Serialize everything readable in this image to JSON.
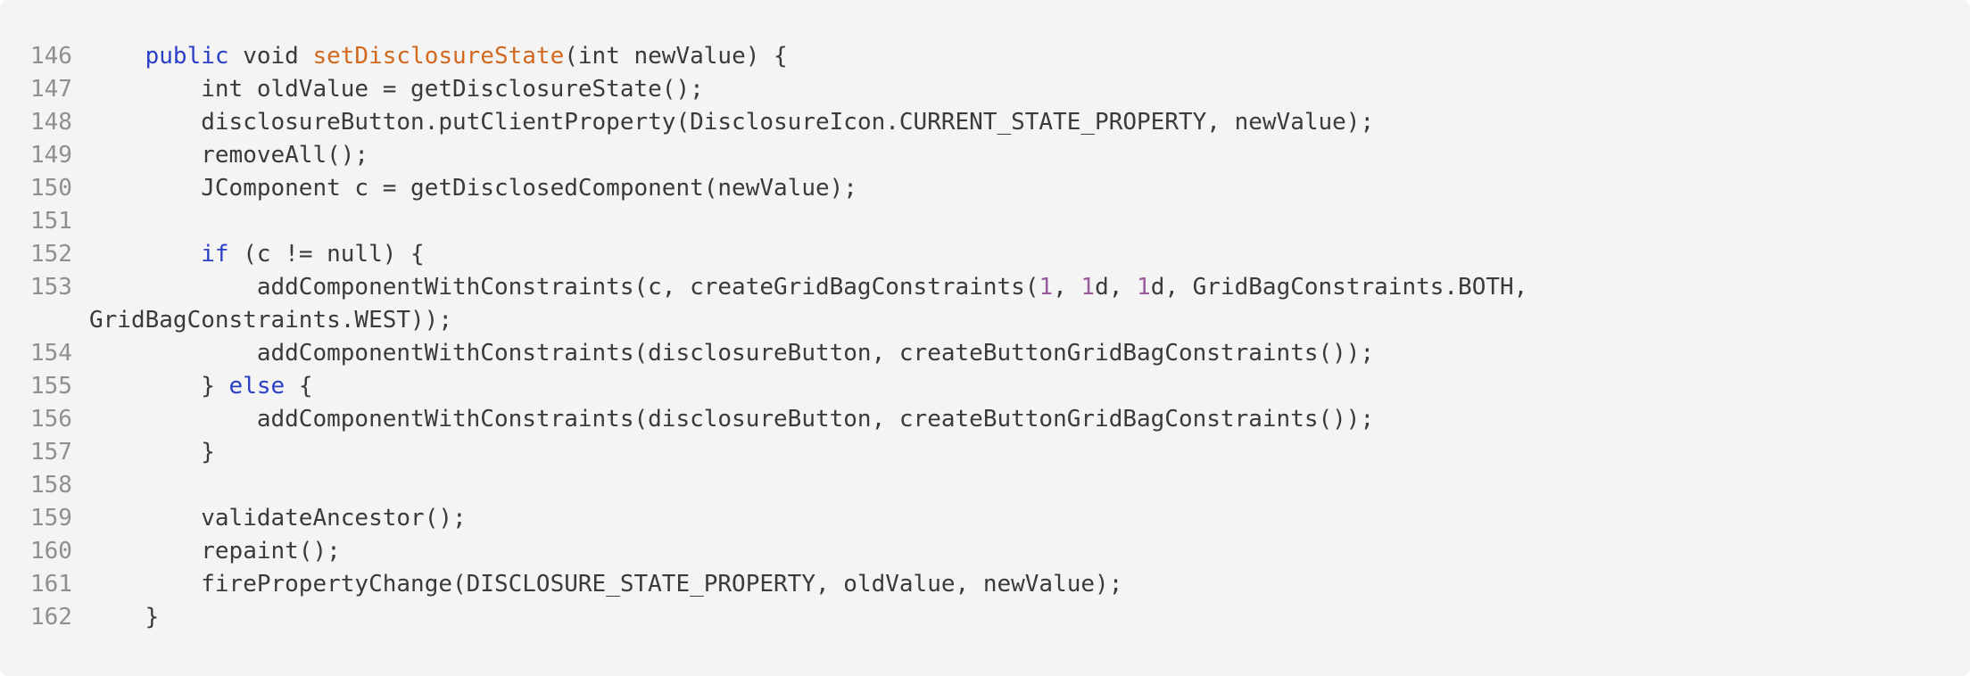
{
  "code_block": {
    "lines": [
      {
        "number": "146",
        "tokens": [
          {
            "type": "plain",
            "text": "    "
          },
          {
            "type": "kw",
            "text": "public"
          },
          {
            "type": "plain",
            "text": " void "
          },
          {
            "type": "fn",
            "text": "setDisclosureState"
          },
          {
            "type": "plain",
            "text": "(int newValue) {"
          }
        ]
      },
      {
        "number": "147",
        "tokens": [
          {
            "type": "plain",
            "text": "        int oldValue = getDisclosureState();"
          }
        ]
      },
      {
        "number": "148",
        "tokens": [
          {
            "type": "plain",
            "text": "        disclosureButton.putClientProperty(DisclosureIcon.CURRENT_STATE_PROPERTY, newValue);"
          }
        ]
      },
      {
        "number": "149",
        "tokens": [
          {
            "type": "plain",
            "text": "        removeAll();"
          }
        ]
      },
      {
        "number": "150",
        "tokens": [
          {
            "type": "plain",
            "text": "        JComponent c = getDisclosedComponent(newValue);"
          }
        ]
      },
      {
        "number": "151",
        "tokens": []
      },
      {
        "number": "152",
        "tokens": [
          {
            "type": "plain",
            "text": "        "
          },
          {
            "type": "kw",
            "text": "if"
          },
          {
            "type": "plain",
            "text": " (c != null) {"
          }
        ]
      },
      {
        "number": "153",
        "wrapped": true,
        "tokens": [
          {
            "type": "plain",
            "text": "            addComponentWithConstraints(c, createGridBagConstraints("
          },
          {
            "type": "num",
            "text": "1"
          },
          {
            "type": "plain",
            "text": ", "
          },
          {
            "type": "num",
            "text": "1"
          },
          {
            "type": "plain",
            "text": "d, "
          },
          {
            "type": "num",
            "text": "1"
          },
          {
            "type": "plain",
            "text": "d, GridBagConstraints.BOTH,\nGridBagConstraints.WEST));"
          }
        ]
      },
      {
        "number": "154",
        "tokens": [
          {
            "type": "plain",
            "text": "            addComponentWithConstraints(disclosureButton, createButtonGridBagConstraints());"
          }
        ]
      },
      {
        "number": "155",
        "tokens": [
          {
            "type": "plain",
            "text": "        } "
          },
          {
            "type": "kw",
            "text": "else"
          },
          {
            "type": "plain",
            "text": " {"
          }
        ]
      },
      {
        "number": "156",
        "tokens": [
          {
            "type": "plain",
            "text": "            addComponentWithConstraints(disclosureButton, createButtonGridBagConstraints());"
          }
        ]
      },
      {
        "number": "157",
        "tokens": [
          {
            "type": "plain",
            "text": "        }"
          }
        ]
      },
      {
        "number": "158",
        "tokens": []
      },
      {
        "number": "159",
        "tokens": [
          {
            "type": "plain",
            "text": "        validateAncestor();"
          }
        ]
      },
      {
        "number": "160",
        "tokens": [
          {
            "type": "plain",
            "text": "        repaint();"
          }
        ]
      },
      {
        "number": "161",
        "tokens": [
          {
            "type": "plain",
            "text": "        firePropertyChange(DISCLOSURE_STATE_PROPERTY, oldValue, newValue);"
          }
        ]
      },
      {
        "number": "162",
        "tokens": [
          {
            "type": "plain",
            "text": "    }"
          }
        ]
      }
    ]
  },
  "colors": {
    "background": "#f4f4f4",
    "line_number": "#8f8f8f",
    "keyword": "#2a3fc7",
    "function_name": "#d2691e",
    "number_literal": "#9a5c9a",
    "plain_text": "#3a3a3a"
  }
}
